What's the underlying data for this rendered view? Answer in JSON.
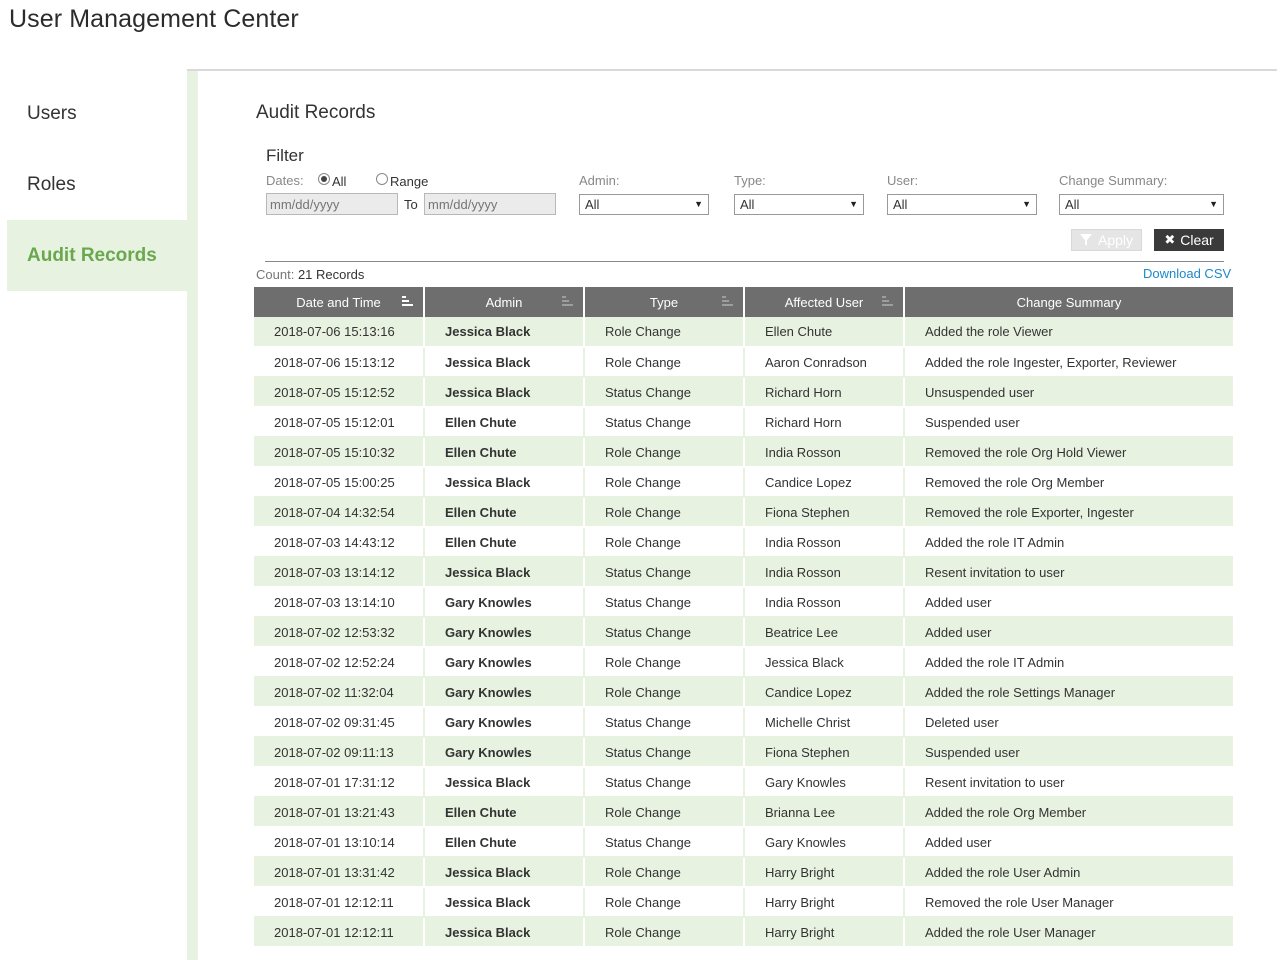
{
  "app": {
    "title": "User Management Center"
  },
  "sidebar": {
    "items": [
      {
        "label": "Users",
        "active": false
      },
      {
        "label": "Roles",
        "active": false
      },
      {
        "label": "Audit Records",
        "active": true
      }
    ]
  },
  "main": {
    "title": "Audit Records"
  },
  "filter": {
    "title": "Filter",
    "dates_label": "Dates:",
    "radio_all": "All",
    "radio_range": "Range",
    "selected_range_option": "All",
    "from_placeholder": "mm/dd/yyyy",
    "to_label": "To",
    "to_placeholder": "mm/dd/yyyy",
    "admin_label": "Admin:",
    "admin_value": "All",
    "type_label": "Type:",
    "type_value": "All",
    "user_label": "User:",
    "user_value": "All",
    "summary_label": "Change Summary:",
    "summary_value": "All",
    "apply_label": "Apply",
    "clear_label": "Clear"
  },
  "count": {
    "label": "Count:",
    "value": "21 Records"
  },
  "download_csv": "Download CSV",
  "table": {
    "columns": [
      "Date and Time",
      "Admin",
      "Type",
      "Affected User",
      "Change Summary"
    ],
    "rows": [
      [
        "2018-07-06 15:13:16",
        "Jessica Black",
        "Role Change",
        "Ellen Chute",
        "Added the role Viewer"
      ],
      [
        "2018-07-06 15:13:12",
        "Jessica Black",
        "Role Change",
        "Aaron Conradson",
        "Added the role Ingester, Exporter, Reviewer"
      ],
      [
        "2018-07-05 15:12:52",
        "Jessica Black",
        "Status Change",
        "Richard Horn",
        "Unsuspended user"
      ],
      [
        "2018-07-05 15:12:01",
        "Ellen Chute",
        "Status Change",
        "Richard Horn",
        "Suspended user"
      ],
      [
        "2018-07-05 15:10:32",
        "Ellen Chute",
        "Role Change",
        "India Rosson",
        "Removed the role Org Hold Viewer"
      ],
      [
        "2018-07-05 15:00:25",
        "Jessica Black",
        "Role Change",
        "Candice Lopez",
        "Removed the role Org Member"
      ],
      [
        "2018-07-04 14:32:54",
        "Ellen Chute",
        "Role Change",
        "Fiona Stephen",
        "Removed the role Exporter, Ingester"
      ],
      [
        "2018-07-03 14:43:12",
        "Ellen Chute",
        "Role Change",
        "India Rosson",
        "Added the role IT Admin"
      ],
      [
        "2018-07-03 13:14:12",
        "Jessica Black",
        "Status Change",
        "India Rosson",
        "Resent invitation to user"
      ],
      [
        "2018-07-03 13:14:10",
        "Gary Knowles",
        "Status Change",
        "India Rosson",
        "Added user"
      ],
      [
        "2018-07-02 12:53:32",
        "Gary Knowles",
        "Status Change",
        "Beatrice Lee",
        "Added user"
      ],
      [
        "2018-07-02 12:52:24",
        "Gary Knowles",
        "Role Change",
        "Jessica Black",
        "Added the role IT Admin"
      ],
      [
        "2018-07-02 11:32:04",
        "Gary Knowles",
        "Role Change",
        "Candice Lopez",
        "Added the role Settings Manager"
      ],
      [
        "2018-07-02 09:31:45",
        "Gary Knowles",
        "Status Change",
        "Michelle Christ",
        "Deleted user"
      ],
      [
        "2018-07-02 09:11:13",
        "Gary Knowles",
        "Status Change",
        "Fiona Stephen",
        "Suspended user"
      ],
      [
        "2018-07-01 17:31:12",
        "Jessica Black",
        "Status Change",
        "Gary Knowles",
        "Resent invitation to user"
      ],
      [
        "2018-07-01 13:21:43",
        "Ellen Chute",
        "Role Change",
        "Brianna Lee",
        "Added the role Org Member"
      ],
      [
        "2018-07-01 13:10:14",
        "Ellen Chute",
        "Status Change",
        "Gary Knowles",
        "Added user"
      ],
      [
        "2018-07-01 13:31:42",
        "Jessica Black",
        "Role Change",
        "Harry Bright",
        "Added the role User Admin"
      ],
      [
        "2018-07-01 12:12:11",
        "Jessica Black",
        "Role Change",
        "Harry Bright",
        "Removed the role User Manager"
      ],
      [
        "2018-07-01 12:12:11",
        "Jessica Black",
        "Role Change",
        "Harry Bright",
        "Added the role User Manager"
      ]
    ]
  },
  "colors": {
    "accent": "#6aa84f",
    "active_bg": "#e8f2e1",
    "header_bg": "#6e6e6e",
    "link": "#1e88c8"
  },
  "icons": {
    "apply": "filter-icon",
    "clear": "x-icon",
    "sort": "sort-icon",
    "dropdown": "chevron-down-icon"
  }
}
